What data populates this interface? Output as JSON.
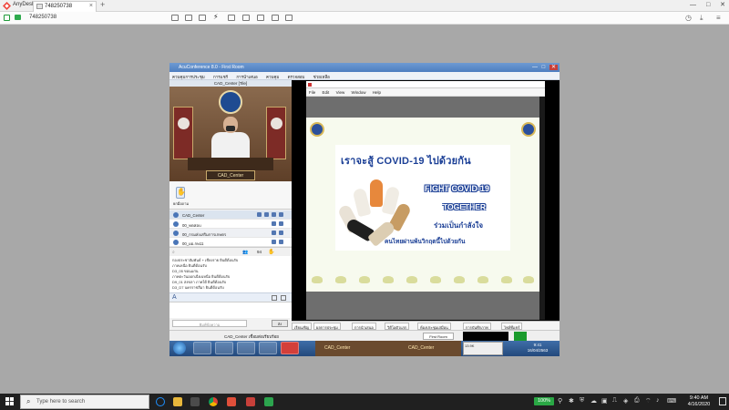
{
  "anydesk": {
    "app_name": "AnyDesk",
    "tab_label": "748250738",
    "tab_close": "×",
    "new_tab": "+",
    "address": "748250738",
    "window_controls": [
      "—",
      "□",
      "✕"
    ]
  },
  "conference": {
    "window_title": "AcuConference 8.0 - First Room",
    "title_controls": [
      "—",
      "□",
      "✕"
    ],
    "menu": [
      "ควบคุมการประชุม",
      "การแชร์",
      "การนำเสนอ",
      "ควบคุม",
      "ตรวจสอบ",
      "ช่วยเหลือ"
    ],
    "video_label": "CAD_Center [Tile]",
    "nameplate": "CAD_Center",
    "raise_hand_label": "ยกมือถาม",
    "raise_hand_icon": "✋",
    "participants": [
      "CAD_Center",
      "00_ทดสอบ",
      "00_กรมส่งเสริมการเกษตร",
      "00_ผอ.กษ11"
    ],
    "participant_count": "94",
    "search_icon": "⌕",
    "people_icon": "👥",
    "hand_icon": "✋",
    "chat_log": [
      "กองประชาสัมพันธ์ + เชียงราย ยินดีต้อนรับ",
      "ภาคเหนือ ยินดีต้อนรับ",
      "D3_05 ขอนแก่น",
      "ภาคตะวันออกเฉียงเหนือ ยินดีต้อนรับ",
      "D9_01 สงขลา ภาคใต้ ยินดีต้อนรับ",
      "D3_D7 นครราชสีมา ยินดีต้อนรับ"
    ],
    "chat_font_icon": "A",
    "chat_entry_placeholder": "พิมพ์ข้อความ",
    "chat_send_label": "ส่ง",
    "viewer_menu": [
      "File",
      "Edit",
      "View",
      "Window",
      "Help"
    ],
    "bottom_tabs": [
      "เรียนเชิญ",
      "ผลการประชุม",
      "การนำเสนอ",
      "วิดีโอตัวแรก",
      "ห้องประชุมเสมือน",
      "การบันทึกภาพ",
      "ไฟล์ที่แชร์"
    ],
    "status_left": "CAD_Center เชื่อมต่อเรียบร้อย",
    "status_mid": "First Room"
  },
  "slide": {
    "headline": "เราจะสู้ COVID-19 ไปด้วยกัน",
    "line_fight": "FIGHT COVID-19",
    "line_together": "TOGETHER",
    "line_thai2": "ร่วมเป็นกำลังใจ",
    "line_thai3": "คนไทยผ่านพ้นวิกฤตนี้ไปด้วยกัน"
  },
  "remote_taskbar": {
    "strip_label": "CAD_Center",
    "notice": "13.9K",
    "clock_time": "9:41",
    "clock_date": "16/04/2563"
  },
  "taskbar": {
    "search_placeholder": "Type here to search",
    "search_icon": "⌕",
    "battery": "100%",
    "time": "9:40 AM",
    "date": "4/16/2020"
  }
}
